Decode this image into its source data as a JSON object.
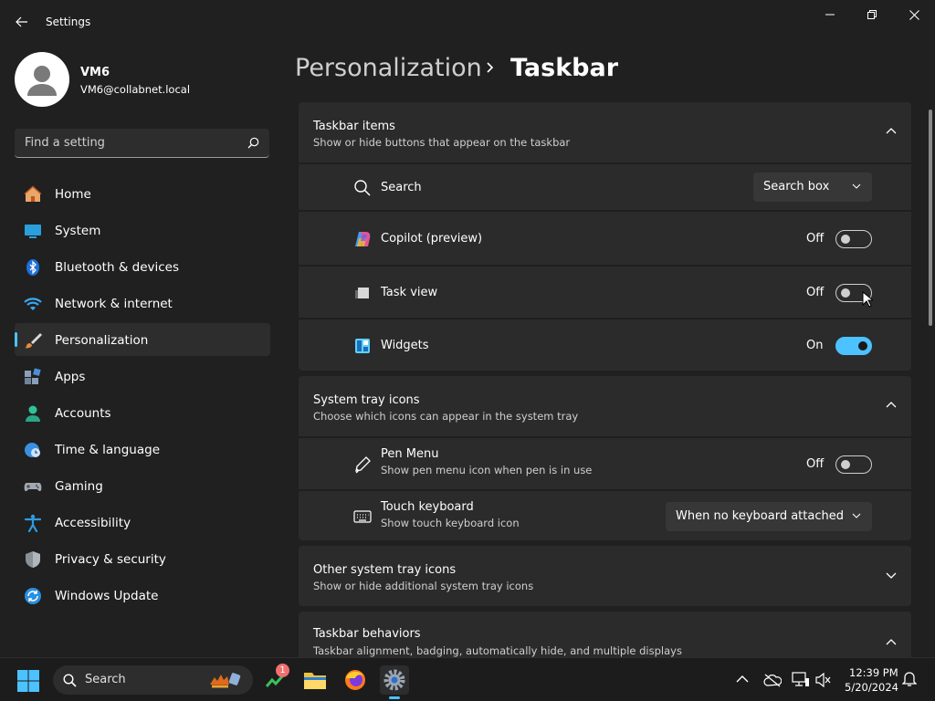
{
  "window": {
    "title": "Settings"
  },
  "user": {
    "name": "VM6",
    "email": "VM6@collabnet.local"
  },
  "search": {
    "placeholder": "Find a setting"
  },
  "nav": {
    "items": [
      {
        "label": "Home",
        "icon": "home-icon"
      },
      {
        "label": "System",
        "icon": "system-icon"
      },
      {
        "label": "Bluetooth & devices",
        "icon": "bluetooth-icon"
      },
      {
        "label": "Network & internet",
        "icon": "wifi-icon"
      },
      {
        "label": "Personalization",
        "icon": "brush-icon",
        "selected": true
      },
      {
        "label": "Apps",
        "icon": "apps-icon"
      },
      {
        "label": "Accounts",
        "icon": "person-icon"
      },
      {
        "label": "Time & language",
        "icon": "globe-clock-icon"
      },
      {
        "label": "Gaming",
        "icon": "gamepad-icon"
      },
      {
        "label": "Accessibility",
        "icon": "accessibility-icon"
      },
      {
        "label": "Privacy & security",
        "icon": "shield-icon"
      },
      {
        "label": "Windows Update",
        "icon": "update-icon"
      }
    ]
  },
  "breadcrumb": {
    "parent": "Personalization",
    "current": "Taskbar"
  },
  "sections": {
    "taskbar_items": {
      "title": "Taskbar items",
      "subtitle": "Show or hide buttons that appear on the taskbar",
      "rows": {
        "search": {
          "label": "Search",
          "value": "Search box"
        },
        "copilot": {
          "label": "Copilot (preview)",
          "state": "Off"
        },
        "task_view": {
          "label": "Task view",
          "state": "Off"
        },
        "widgets": {
          "label": "Widgets",
          "state": "On"
        }
      }
    },
    "system_tray": {
      "title": "System tray icons",
      "subtitle": "Choose which icons can appear in the system tray",
      "rows": {
        "pen_menu": {
          "label": "Pen Menu",
          "subtitle": "Show pen menu icon when pen is in use",
          "state": "Off"
        },
        "touch_keyboard": {
          "label": "Touch keyboard",
          "subtitle": "Show touch keyboard icon",
          "value": "When no keyboard attached"
        }
      }
    },
    "other_tray": {
      "title": "Other system tray icons",
      "subtitle": "Show or hide additional system tray icons"
    },
    "behaviors": {
      "title": "Taskbar behaviors",
      "subtitle": "Taskbar alignment, badging, automatically hide, and multiple displays"
    }
  },
  "taskbar": {
    "search_label": "Search",
    "badge_count": "1",
    "time": "12:39 PM",
    "date": "5/20/2024"
  },
  "colors": {
    "accent": "#4cc2ff",
    "background": "#202020",
    "card": "#2b2b2b"
  }
}
